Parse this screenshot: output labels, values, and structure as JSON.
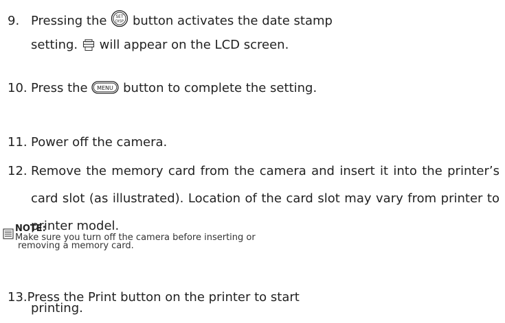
{
  "steps": {
    "s9": {
      "num": "9.",
      "part1": "Pressing the",
      "icon": "set-disp-button-icon",
      "icon_text_top": "SET",
      "icon_text_bottom": "DISP",
      "part2": "button activates the date stamp",
      "line2_icon": "date-stamp-icon",
      "line2_prefix": "setting.",
      "line2_suffix": "will appear on the LCD screen."
    },
    "s10": {
      "num": "10.",
      "part1": "Press the",
      "icon": "menu-button-icon",
      "icon_text": "MENU",
      "part2": "button to complete the setting."
    },
    "s11": {
      "num": "11.",
      "text": "Power off the camera."
    },
    "s12": {
      "num": "12.",
      "text": "Remove the memory card from the camera and insert it into the printer’s card slot (as illustrated). Location of the card slot may vary from printer to printer model."
    },
    "s13": {
      "num": "13.",
      "line1": "Press the Print button on the printer to start",
      "line2": "printing."
    }
  },
  "note": {
    "icon": "memo-icon",
    "title": "NOTE:",
    "line1": "Make sure you turn off the camera before inserting or",
    "line2": "removing a memory card."
  }
}
